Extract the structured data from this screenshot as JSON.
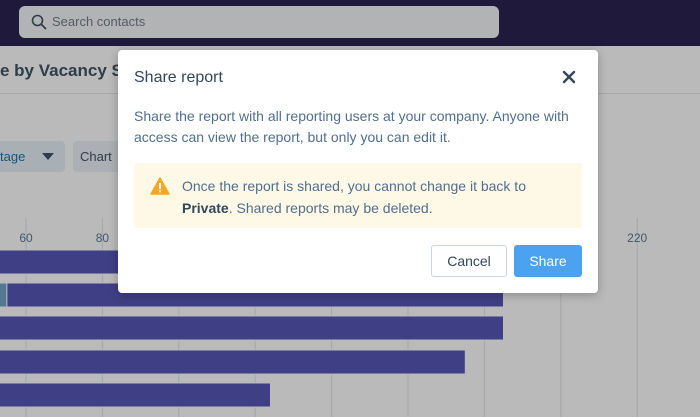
{
  "search": {
    "placeholder": "Search contacts",
    "icon": "search-icon"
  },
  "report": {
    "title": "e by Vacancy Sta",
    "filters": {
      "stage_label": "tage",
      "chart_label": "Chart"
    },
    "axis_ticks": [
      "60",
      "80",
      "220"
    ]
  },
  "chart_data": {
    "type": "bar",
    "orientation": "horizontal",
    "stacked": true,
    "x_ticks": [
      60,
      80,
      220
    ],
    "colors": [
      "#e7c141",
      "#0c7c5f",
      "#6e9dc2",
      "#4a4ab2"
    ],
    "rows": [
      [
        2,
        25,
        4,
        160
      ],
      [
        0,
        14,
        41,
        130
      ],
      [
        0,
        4,
        38,
        143
      ],
      [
        0,
        12,
        23,
        140
      ],
      [
        0,
        0,
        0,
        124
      ]
    ]
  },
  "modal": {
    "title": "Share report",
    "close_icon": "close-icon",
    "body": "Share the report with all reporting users at your company. Anyone with access can view the report, but only you can edit it.",
    "alert": {
      "icon": "warning-icon",
      "text_before": "Once the report is shared, you cannot change it back to",
      "text_bold": "Private",
      "text_after": ". Shared reports may be deleted."
    },
    "cancel_label": "Cancel",
    "share_label": "Share"
  },
  "colors": {
    "primary_button": "#4aa2f0",
    "alert_background": "#fef8e6",
    "warning": "#f5a623",
    "topbar": "#1b1445"
  }
}
